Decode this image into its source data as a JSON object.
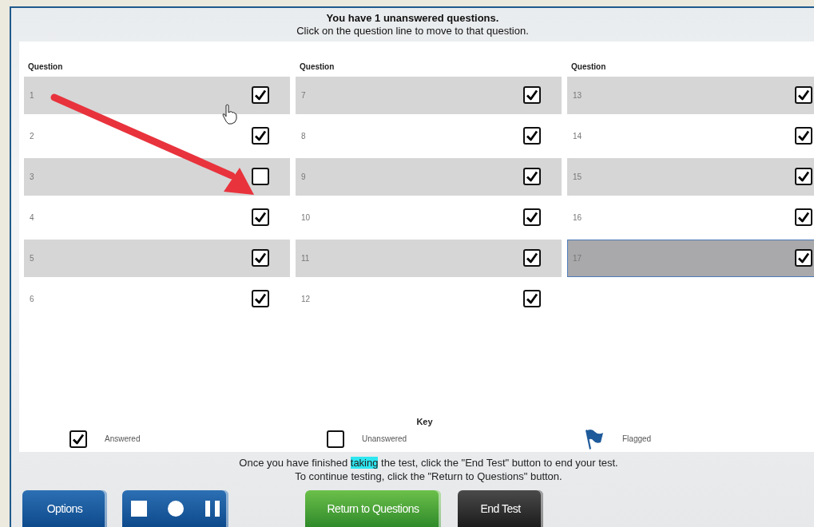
{
  "summary": {
    "title": "You have 1 unanswered questions.",
    "subtitle": "Click on the question line to move to that question."
  },
  "columns": [
    {
      "header": "Question",
      "questions": [
        {
          "number": "1",
          "answered": true,
          "selected": false
        },
        {
          "number": "2",
          "answered": true,
          "selected": false
        },
        {
          "number": "3",
          "answered": false,
          "selected": false
        },
        {
          "number": "4",
          "answered": true,
          "selected": false
        },
        {
          "number": "5",
          "answered": true,
          "selected": false
        },
        {
          "number": "6",
          "answered": true,
          "selected": false
        }
      ]
    },
    {
      "header": "Question",
      "questions": [
        {
          "number": "7",
          "answered": true,
          "selected": false
        },
        {
          "number": "8",
          "answered": true,
          "selected": false
        },
        {
          "number": "9",
          "answered": true,
          "selected": false
        },
        {
          "number": "10",
          "answered": true,
          "selected": false
        },
        {
          "number": "11",
          "answered": true,
          "selected": false
        },
        {
          "number": "12",
          "answered": true,
          "selected": false
        }
      ]
    },
    {
      "header": "Question",
      "questions": [
        {
          "number": "13",
          "answered": true,
          "selected": false
        },
        {
          "number": "14",
          "answered": true,
          "selected": false
        },
        {
          "number": "15",
          "answered": true,
          "selected": false
        },
        {
          "number": "16",
          "answered": true,
          "selected": false
        },
        {
          "number": "17",
          "answered": true,
          "selected": true
        }
      ]
    }
  ],
  "key": {
    "title": "Key",
    "items": [
      {
        "kind": "answered",
        "label": "Answered"
      },
      {
        "kind": "unanswered",
        "label": "Unanswered"
      },
      {
        "kind": "flagged",
        "label": "Flagged"
      }
    ]
  },
  "instructions": [
    {
      "before": "Once you have finished ",
      "highlight": "taking",
      "after": " the test, click the \"End Test\" button to end your test."
    },
    {
      "before": "To continue testing, click the \"Return to Questions\" button."
    }
  ],
  "buttons": [
    {
      "kind": "options",
      "label": "Options"
    },
    {
      "kind": "media"
    },
    {
      "kind": "return",
      "label": "Return to Questions"
    },
    {
      "kind": "end",
      "label": "End Test"
    }
  ]
}
